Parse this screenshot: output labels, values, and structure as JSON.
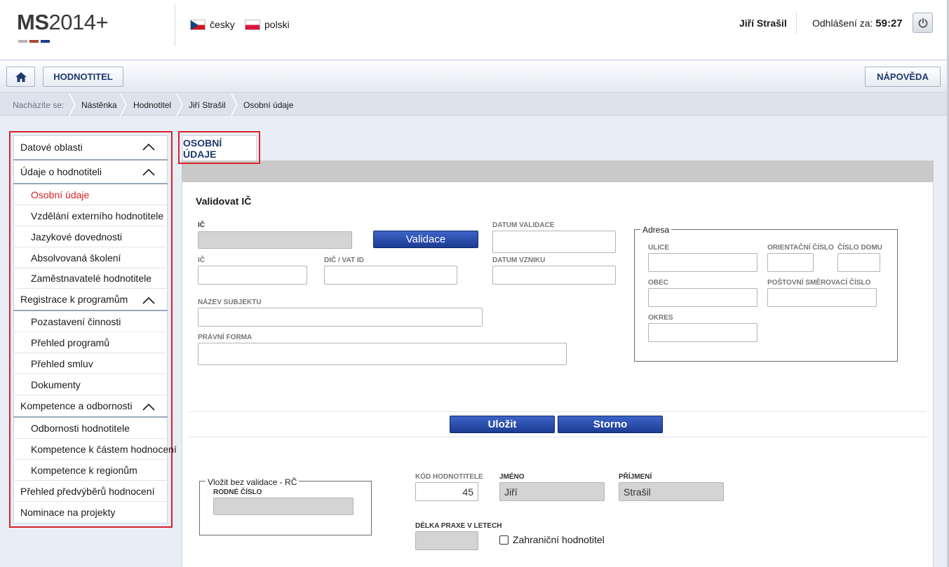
{
  "header": {
    "logo": {
      "prefix": "MS",
      "suffix": "2014+"
    },
    "languages": [
      {
        "label": "česky",
        "flag": "flag-cz"
      },
      {
        "label": "polski",
        "flag": "flag-pl"
      }
    ],
    "user_name": "Jiří Strašil",
    "logout_label": "Odhlášení za:",
    "logout_time": "59:27",
    "power_icon": "power-icon"
  },
  "toolbar": {
    "home_icon": "home-icon",
    "role_label": "HODNOTITEL",
    "help_label": "NÁPOVĚDA"
  },
  "breadcrumb": {
    "label": "Nacházíte se:",
    "items": [
      "Nástěnka",
      "Hodnotitel",
      "Jiří Strašil",
      "Osobní údaje"
    ]
  },
  "menu": {
    "items": [
      {
        "label": "Datové oblasti",
        "type": "section"
      },
      {
        "label": "Údaje o hodnotiteli",
        "type": "section"
      },
      {
        "label": "Osobní údaje",
        "type": "sub",
        "active": true
      },
      {
        "label": "Vzdělání externího hodnotitele",
        "type": "sub"
      },
      {
        "label": "Jazykové dovednosti",
        "type": "sub"
      },
      {
        "label": "Absolvovaná školení",
        "type": "sub"
      },
      {
        "label": "Zaměstnavatelé hodnotitele",
        "type": "sub"
      },
      {
        "label": "Registrace k programům",
        "type": "section"
      },
      {
        "label": "Pozastavení činnosti",
        "type": "sub"
      },
      {
        "label": "Přehled programů",
        "type": "sub"
      },
      {
        "label": "Přehled smluv",
        "type": "sub"
      },
      {
        "label": "Dokumenty",
        "type": "sub"
      },
      {
        "label": "Kompetence a odbornosti",
        "type": "section"
      },
      {
        "label": "Odbornosti hodnotitele",
        "type": "sub"
      },
      {
        "label": "Kompetence k částem hodnocení",
        "type": "sub"
      },
      {
        "label": "Kompetence k regionům",
        "type": "sub"
      },
      {
        "label": "Přehled předvýběrů hodnocení",
        "type": "top"
      },
      {
        "label": "Nominace na projekty",
        "type": "top"
      }
    ]
  },
  "tab": {
    "label": "OSOBNÍ ÚDAJE"
  },
  "form": {
    "section_title": "Validovat IČ",
    "labels": {
      "ic_validate": "IČ",
      "datum_validace": "DATUM VALIDACE",
      "ic": "IČ",
      "dic": "DIČ / VAT ID",
      "datum_vzniku": "DATUM VZNIKU",
      "nazev_subjektu": "NÁZEV SUBJEKTU",
      "pravni_forma": "PRÁVNÍ FORMA",
      "ulice": "ULICE",
      "orientacni_cislo": "ORIENTAČNÍ ČÍSLO",
      "cislo_domu": "ČÍSLO DOMU",
      "obec": "OBEC",
      "psc": "POŠTOVNÍ SMĚROVACÍ ČÍSLO",
      "okres": "OKRES",
      "rodne_cislo": "RODNÉ ČÍSLO",
      "kod_hodnotitele": "KÓD HODNOTITELE",
      "jmeno": "JMÉNO",
      "prijmeni": "PŘÍJMENÍ",
      "delka_praxe": "DÉLKA PRAXE V LETECH"
    },
    "address_legend": "Adresa",
    "rc_legend": "Vložit bez validace - RČ",
    "buttons": {
      "validace": "Validace",
      "ulozit": "Uložit",
      "storno": "Storno"
    },
    "values": {
      "kod_hodnotitele": "45",
      "jmeno": "Jiří",
      "prijmeni": "Strašil"
    },
    "checkbox_foreign": "Zahraniční hodnotitel"
  },
  "colors": {
    "accent_red": "#d8232a",
    "brand_blue": "#1f3a6d",
    "button_blue": "#2a4fb0"
  }
}
